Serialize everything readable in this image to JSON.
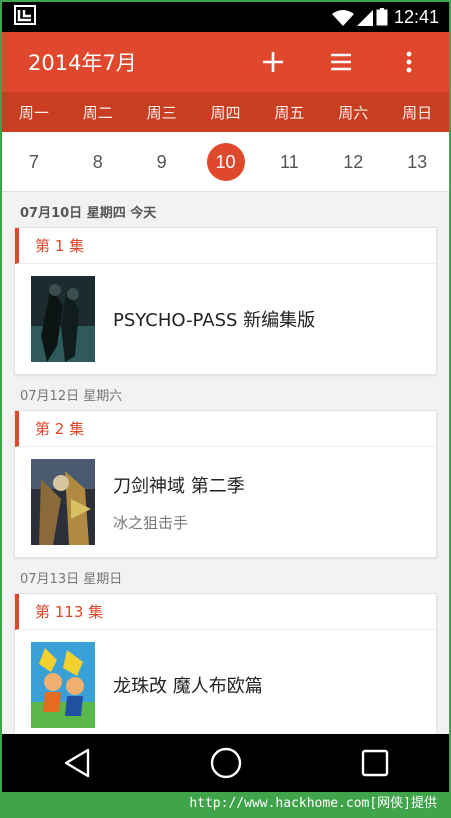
{
  "status_bar": {
    "left_icon": "notification-icon",
    "time": "12:41"
  },
  "app_bar": {
    "title": "2014年7月",
    "add_icon": "plus-icon",
    "list_icon": "menu-icon",
    "more_icon": "more-vert-icon"
  },
  "weekdays": [
    "周一",
    "周二",
    "周三",
    "周四",
    "周五",
    "周六",
    "周日"
  ],
  "dates": [
    "7",
    "8",
    "9",
    "10",
    "11",
    "12",
    "13"
  ],
  "selected_date": "10",
  "sections": [
    {
      "header": "07月10日 星期四 今天",
      "episode": "第 1 集",
      "title": "PSYCHO-PASS 新编集版",
      "subtitle": ""
    },
    {
      "header": "07月12日 星期六",
      "episode": "第 2 集",
      "title": "刀剑神域 第二季",
      "subtitle": "冰之狙击手"
    },
    {
      "header": "07月13日 星期日",
      "episode": "第 113 集",
      "title": "龙珠改 魔人布欧篇",
      "subtitle": ""
    }
  ],
  "footer": "http://www.hackhome.com[网侠]提供",
  "colors": {
    "accent": "#e0482e",
    "accent_dark": "#c93d22"
  }
}
